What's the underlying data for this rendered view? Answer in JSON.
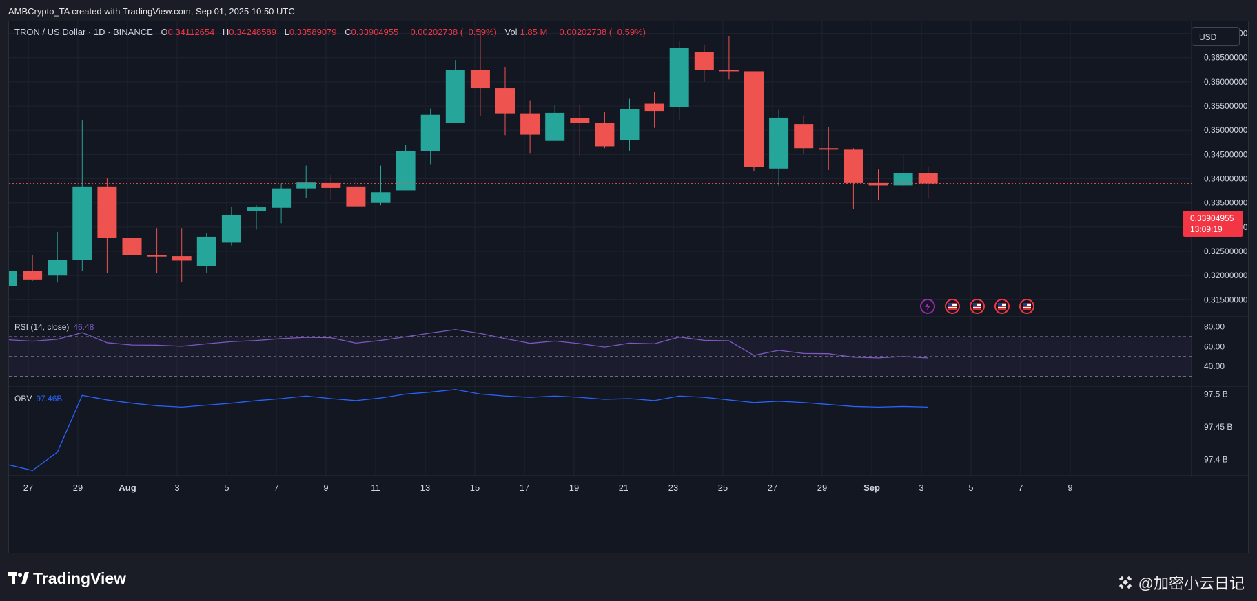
{
  "caption": "AMBCrypto_TA created with TradingView.com, Sep 01, 2025 10:50 UTC",
  "legend": {
    "symbol": "TRON / US Dollar · 1D · BINANCE",
    "o_label": "O",
    "o_value": "0.34112654",
    "h_label": "H",
    "h_value": "0.34248589",
    "l_label": "L",
    "l_value": "0.33589079",
    "c_label": "C",
    "c_value": "0.33904955",
    "change": "−0.00202738 (−0.59%)",
    "vol_label": "Vol",
    "vol_value": "1.85 M",
    "vol_change": "−0.00202738 (−0.59%)"
  },
  "currency_button": "USD",
  "last_price": "0.33904955",
  "countdown": "13:09:19",
  "rsi": {
    "label": "RSI (14, close)",
    "value": "46.48"
  },
  "obv": {
    "label": "OBV",
    "value": "97.46B"
  },
  "brand": "TradingView",
  "watermark": "@加密小云日记",
  "colors": {
    "up": "#26a69a",
    "down": "#ef5350",
    "rsi": "#7e57c2",
    "obv": "#2962ff",
    "background": "#131722"
  },
  "event_icons": [
    "lightning-icon",
    "us-flag-icon",
    "us-flag-icon",
    "us-flag-icon",
    "us-flag-icon"
  ],
  "chart_data": {
    "type": "candlestick",
    "price_axis_ticks": [
      "0.37000000",
      "0.36500000",
      "0.36000000",
      "0.35500000",
      "0.35000000",
      "0.34500000",
      "0.34000000",
      "0.33500000",
      "0.33000000",
      "0.32500000",
      "0.32000000",
      "0.31500000"
    ],
    "price_range": [
      0.3115,
      0.3725
    ],
    "time_axis_ticks": [
      "27",
      "29",
      "Aug",
      "3",
      "5",
      "7",
      "9",
      "11",
      "13",
      "15",
      "17",
      "19",
      "21",
      "23",
      "25",
      "27",
      "29",
      "Sep",
      "3",
      "5",
      "7",
      "9"
    ],
    "candles": [
      {
        "o": 0.3178,
        "h": 0.321,
        "l": 0.3178,
        "c": 0.321
      },
      {
        "o": 0.321,
        "h": 0.3242,
        "l": 0.3189,
        "c": 0.3192
      },
      {
        "o": 0.32,
        "h": 0.329,
        "l": 0.3186,
        "c": 0.3233
      },
      {
        "o": 0.3233,
        "h": 0.352,
        "l": 0.321,
        "c": 0.3384
      },
      {
        "o": 0.3384,
        "h": 0.3402,
        "l": 0.3205,
        "c": 0.3278
      },
      {
        "o": 0.3278,
        "h": 0.3305,
        "l": 0.3237,
        "c": 0.3242
      },
      {
        "o": 0.3242,
        "h": 0.3298,
        "l": 0.3205,
        "c": 0.3241
      },
      {
        "o": 0.324,
        "h": 0.3298,
        "l": 0.3186,
        "c": 0.3231
      },
      {
        "o": 0.322,
        "h": 0.3288,
        "l": 0.3205,
        "c": 0.328
      },
      {
        "o": 0.3268,
        "h": 0.3342,
        "l": 0.3262,
        "c": 0.3325
      },
      {
        "o": 0.3334,
        "h": 0.3345,
        "l": 0.3295,
        "c": 0.3341
      },
      {
        "o": 0.334,
        "h": 0.339,
        "l": 0.3308,
        "c": 0.338
      },
      {
        "o": 0.338,
        "h": 0.3427,
        "l": 0.336,
        "c": 0.3392
      },
      {
        "o": 0.3391,
        "h": 0.3408,
        "l": 0.3357,
        "c": 0.3381
      },
      {
        "o": 0.3384,
        "h": 0.3403,
        "l": 0.3341,
        "c": 0.3343
      },
      {
        "o": 0.335,
        "h": 0.3427,
        "l": 0.3345,
        "c": 0.3372
      },
      {
        "o": 0.3376,
        "h": 0.347,
        "l": 0.3376,
        "c": 0.3457
      },
      {
        "o": 0.3457,
        "h": 0.3545,
        "l": 0.343,
        "c": 0.3532
      },
      {
        "o": 0.3516,
        "h": 0.3645,
        "l": 0.3516,
        "c": 0.3625
      },
      {
        "o": 0.3625,
        "h": 0.3708,
        "l": 0.353,
        "c": 0.3587
      },
      {
        "o": 0.3587,
        "h": 0.363,
        "l": 0.349,
        "c": 0.3535
      },
      {
        "o": 0.3535,
        "h": 0.3562,
        "l": 0.3453,
        "c": 0.3491
      },
      {
        "o": 0.3478,
        "h": 0.3553,
        "l": 0.3478,
        "c": 0.3536
      },
      {
        "o": 0.3525,
        "h": 0.3552,
        "l": 0.3448,
        "c": 0.3515
      },
      {
        "o": 0.3515,
        "h": 0.3538,
        "l": 0.3463,
        "c": 0.3467
      },
      {
        "o": 0.348,
        "h": 0.3565,
        "l": 0.3458,
        "c": 0.3543
      },
      {
        "o": 0.3555,
        "h": 0.358,
        "l": 0.3505,
        "c": 0.354
      },
      {
        "o": 0.3548,
        "h": 0.3685,
        "l": 0.3522,
        "c": 0.367
      },
      {
        "o": 0.3661,
        "h": 0.3677,
        "l": 0.36,
        "c": 0.3625
      },
      {
        "o": 0.3625,
        "h": 0.3695,
        "l": 0.3605,
        "c": 0.3622
      },
      {
        "o": 0.3622,
        "h": 0.3622,
        "l": 0.3415,
        "c": 0.3425
      },
      {
        "o": 0.3421,
        "h": 0.3542,
        "l": 0.3385,
        "c": 0.3526
      },
      {
        "o": 0.3513,
        "h": 0.3531,
        "l": 0.3451,
        "c": 0.3463
      },
      {
        "o": 0.3463,
        "h": 0.3507,
        "l": 0.3418,
        "c": 0.346
      },
      {
        "o": 0.346,
        "h": 0.3463,
        "l": 0.3337,
        "c": 0.3391
      },
      {
        "o": 0.3391,
        "h": 0.3419,
        "l": 0.3356,
        "c": 0.3386
      },
      {
        "o": 0.3386,
        "h": 0.345,
        "l": 0.3383,
        "c": 0.3411
      },
      {
        "o": 0.3411,
        "h": 0.3425,
        "l": 0.3359,
        "c": 0.339
      }
    ],
    "candle_start_day_index": 0,
    "rsi_ticks": [
      "80.00",
      "60.00",
      "40.00"
    ],
    "rsi_levels": {
      "upper": 70,
      "middle": 50,
      "lower": 30
    },
    "rsi_values": [
      66.8,
      65.3,
      67.2,
      74.0,
      63.8,
      61.5,
      61.3,
      60.3,
      62.7,
      64.9,
      66.0,
      67.9,
      69.1,
      68.8,
      63.4,
      66.1,
      69.7,
      73.6,
      77.0,
      73.2,
      67.9,
      63.2,
      65.5,
      62.9,
      59.4,
      63.4,
      62.7,
      69.5,
      66.2,
      65.7,
      51.1,
      56.1,
      53.0,
      52.8,
      49.2,
      48.5,
      49.9,
      48.4
    ],
    "obv_ticks": [
      "97.5 B",
      "97.45 B",
      "97.4 B"
    ],
    "obv_values": [
      97.392,
      97.383,
      97.411,
      97.498,
      97.491,
      97.486,
      97.482,
      97.48,
      97.483,
      97.486,
      97.49,
      97.493,
      97.497,
      97.493,
      97.49,
      97.494,
      97.5,
      97.503,
      97.507,
      97.5,
      97.497,
      97.495,
      97.497,
      97.495,
      97.492,
      97.493,
      97.49,
      97.497,
      97.495,
      97.491,
      97.487,
      97.489,
      97.487,
      97.484,
      97.481,
      97.48,
      97.481,
      97.48
    ]
  }
}
